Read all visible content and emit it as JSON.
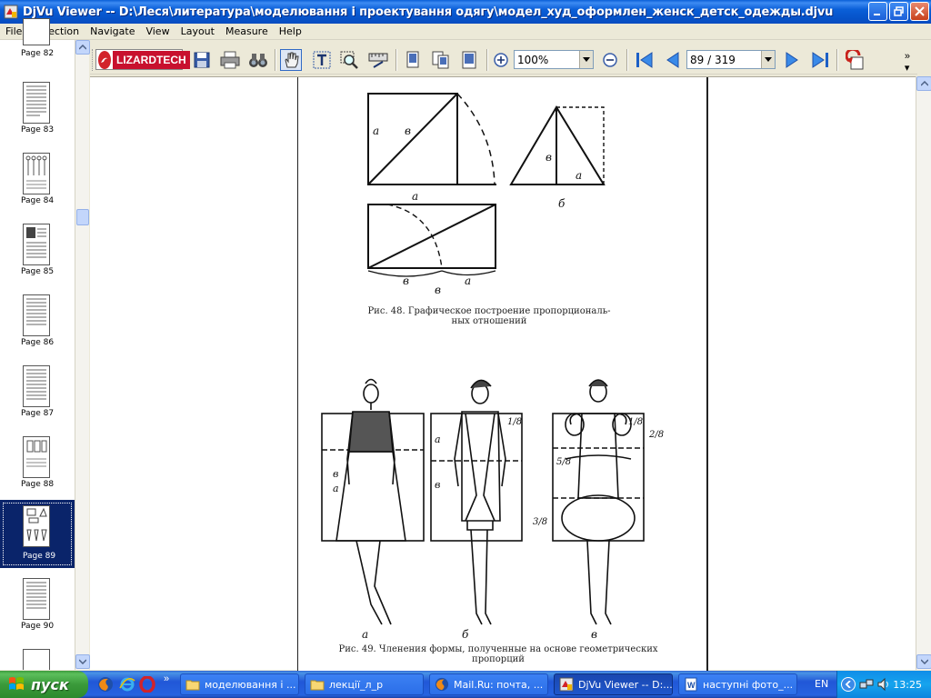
{
  "window": {
    "title": "DjVu Viewer -- D:\\Леся\\литература\\моделювання і проектування одягу\\модел_худ_оформлен_женск_детск_одежды.djvu"
  },
  "menu": [
    "File",
    "Selection",
    "Navigate",
    "View",
    "Layout",
    "Measure",
    "Help"
  ],
  "thumbnails": [
    {
      "label": "Page 82",
      "selected": false
    },
    {
      "label": "Page 83",
      "selected": false
    },
    {
      "label": "Page 84",
      "selected": false
    },
    {
      "label": "Page 85",
      "selected": false
    },
    {
      "label": "Page 86",
      "selected": false
    },
    {
      "label": "Page 87",
      "selected": false
    },
    {
      "label": "Page 88",
      "selected": false
    },
    {
      "label": "Page 89",
      "selected": true
    },
    {
      "label": "Page 90",
      "selected": false
    }
  ],
  "toolbar": {
    "logo_text": "LIZARDTECH",
    "zoom": "100%",
    "page": "89 / 319"
  },
  "document": {
    "fig48_caption_line1": "Рис. 48. Графическое построение пропорциональ-",
    "fig48_caption_line2": "ных отношений",
    "fig48_labels": {
      "a1": "a",
      "v1": "в",
      "a_under": "а",
      "v2": "в",
      "a2": "а",
      "b_under": "б",
      "v3": "в",
      "v4": "в",
      "a3": "а"
    },
    "fig49_caption_line1": "Рис. 49. Членения формы, полученные на основе геометрических",
    "fig49_caption_line2": "пропорций",
    "fig49_labels": {
      "a": "а",
      "b": "б",
      "v": "в",
      "f1": "1/8",
      "f2": "1/8",
      "f3": "2/8",
      "f4": "5/8",
      "f5": "3/8",
      "la": "а",
      "lb": "в",
      "lc": "а",
      "ld": "в"
    }
  },
  "taskbar": {
    "start_label": "пуск",
    "tasks": [
      {
        "label": "моделювання і ...",
        "active": false
      },
      {
        "label": "лекції_л_р",
        "active": false
      },
      {
        "label": "Mail.Ru: почта, ...",
        "active": false
      },
      {
        "label": "DjVu Viewer -- D:...",
        "active": true
      },
      {
        "label": "наступні фото_...",
        "active": false
      }
    ],
    "language": "EN",
    "clock": "13:25"
  }
}
